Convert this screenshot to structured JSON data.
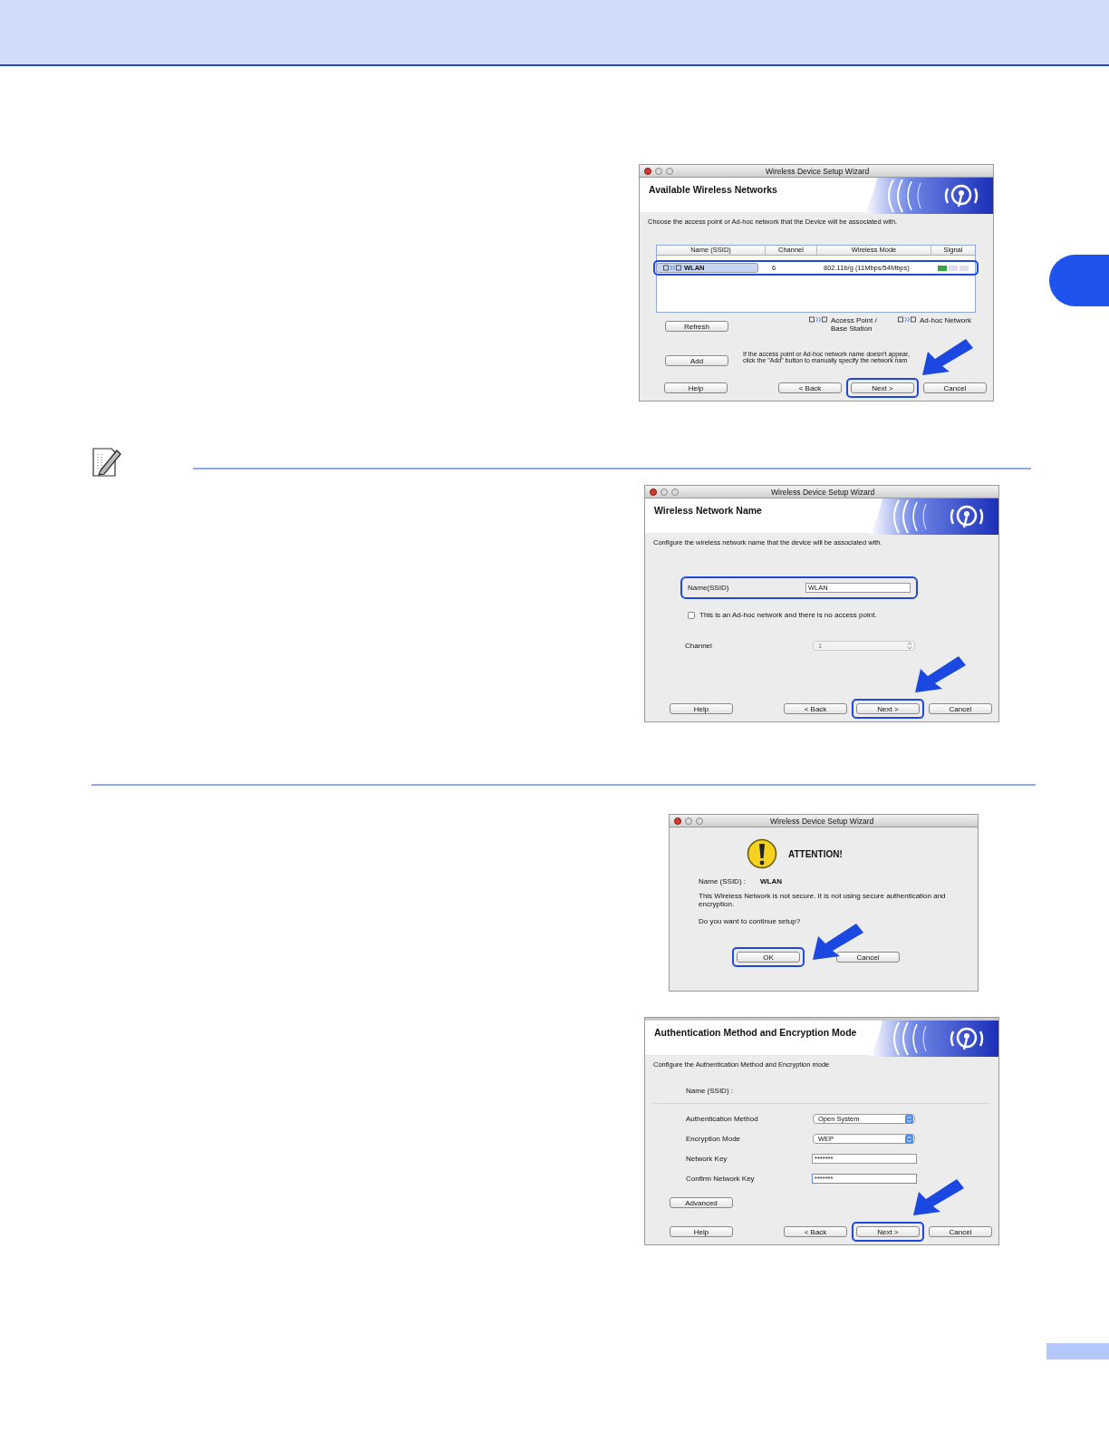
{
  "network_list_window": {
    "title": "Wireless Device Setup Wizard",
    "heading": "Available Wireless Networks",
    "instruction": "Choose the access point or Ad-hoc network that the Device will be associated with.",
    "columns": [
      "Name (SSID)",
      "Channel",
      "Wireless Mode",
      "Signal"
    ],
    "rows": [
      {
        "name": "WLAN",
        "channel": "6",
        "mode": "802.11b/g (11Mbps/54Mbps)",
        "selected": true
      }
    ],
    "legend": [
      "Access Point / Base Station",
      "Ad-hoc Network"
    ],
    "side_buttons": [
      "Refresh",
      "Add"
    ],
    "add_hint": "If the access point or Ad-hoc network name doesn't appear, click the \"Add\" button to manually specify the network nam",
    "buttons": [
      {
        "label": "Help",
        "highlighted": false
      },
      {
        "label": "< Back",
        "highlighted": false
      },
      {
        "label": "Next >",
        "highlighted": true
      },
      {
        "label": "Cancel",
        "highlighted": false
      }
    ]
  },
  "network_name_window": {
    "title": "Wireless Device Setup Wizard",
    "heading": "Wireless Network Name",
    "instruction": "Configure the wireless network name that the device will be associated with.",
    "name_label": "Name(SSID)",
    "name_value": "WLAN",
    "name_highlighted": true,
    "adhoc_checkbox": {
      "label": "This is an Ad-hoc network and there is no access point.",
      "checked": false
    },
    "channel": {
      "label": "Channel",
      "value": "1",
      "disabled": true
    },
    "buttons": [
      {
        "label": "Help",
        "highlighted": false
      },
      {
        "label": "< Back",
        "highlighted": false
      },
      {
        "label": "Next >",
        "highlighted": true
      },
      {
        "label": "Cancel",
        "highlighted": false
      }
    ]
  },
  "attention_dialog": {
    "title": "Wireless Device Setup Wizard",
    "heading": "ATTENTION!",
    "ssid_label": "Name (SSID) :",
    "ssid_value": "WLAN",
    "message": "This Wireless Network is not secure. It is not using secure authentication and encryption.",
    "question": "Do you want to continue setup?",
    "buttons": [
      {
        "label": "OK",
        "highlighted": true
      },
      {
        "label": "Cancel",
        "highlighted": false
      }
    ]
  },
  "authentication_window": {
    "heading": "Authentication Method and Encryption Mode",
    "instruction": "Configure the Authentication Method and Encryption mode",
    "ssid_label": "Name (SSID) :",
    "fields": [
      {
        "kind": "select",
        "label": "Authentication Method",
        "value": "Open System"
      },
      {
        "kind": "select",
        "label": "Encryption Mode",
        "value": "WEP"
      },
      {
        "kind": "password",
        "label": "Network Key",
        "value": "*******",
        "focused": false
      },
      {
        "kind": "password",
        "label": "Confirm Network Key",
        "value": "*******",
        "focused": true
      }
    ],
    "advanced_button": "Advanced",
    "buttons": [
      {
        "label": "Help",
        "highlighted": false
      },
      {
        "label": "< Back",
        "highlighted": false
      },
      {
        "label": "Next >",
        "highlighted": true
      },
      {
        "label": "Cancel",
        "highlighted": false
      }
    ]
  }
}
